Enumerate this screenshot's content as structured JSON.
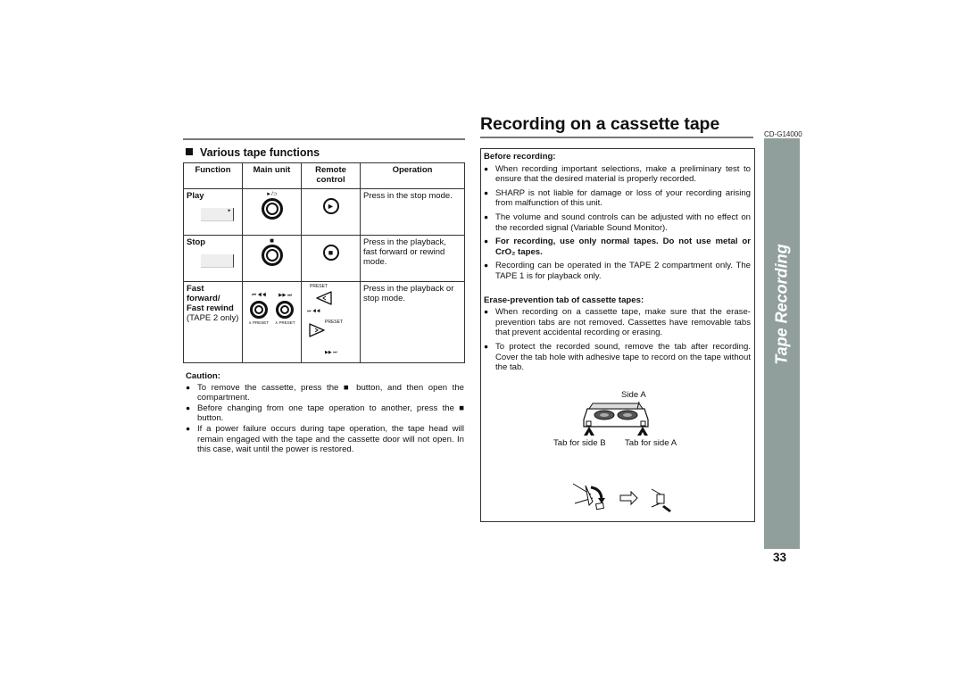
{
  "header": {
    "title": "Recording on a cassette tape",
    "model": "CD-G14000"
  },
  "section": {
    "title": "Various tape functions",
    "table": {
      "headers": [
        "Function",
        "Main unit",
        "Remote control",
        "Operation"
      ],
      "rows": [
        {
          "function": "Play",
          "function_note": "",
          "main_unit_symbol": "►/⊃",
          "remote_symbol": "►",
          "operation": "Press in the stop mode."
        },
        {
          "function": "Stop",
          "function_note": "",
          "main_unit_symbol": "■",
          "remote_symbol": "■",
          "operation": "Press in the playback, fast forward or rewind mode."
        },
        {
          "function": "Fast forward/ Fast rewind",
          "function_note": "(TAPE 2 only)",
          "main_unit_left_symbol": "⏮ ◀◀",
          "main_unit_right_symbol": "▶▶ ⏭",
          "main_unit_left_label": "∨ PRESET",
          "main_unit_right_label": "∧ PRESET",
          "remote_top_label": "PRESET",
          "remote_top_symbol": "⏮ ◀◀",
          "remote_bottom_label": "PRESET",
          "remote_bottom_symbol": "▶▶ ⏭",
          "operation": "Press in the playback or stop mode."
        }
      ]
    }
  },
  "caution": {
    "title": "Caution:",
    "items": [
      "To remove the cassette, press the ■ button, and then open the compartment.",
      "Before changing from one tape operation to another, press the ■ button.",
      "If a power failure occurs during tape operation, the tape head will remain engaged with the tape and the cassette door will not open. In this case, wait until the power is restored."
    ]
  },
  "before_recording": {
    "title": "Before recording:",
    "items": [
      "When recording important selections, make a preliminary test to ensure that the desired material is properly recorded.",
      "SHARP is not liable for damage or loss of your recording arising from malfunction of this unit.",
      "The volume and sound controls can be adjusted with no effect on the recorded signal (Variable Sound Monitor).",
      "For recording, use only normal tapes. Do not use metal or CrO₂ tapes.",
      "Recording can be operated in the TAPE 2 compartment only. The TAPE 1 is for playback only."
    ]
  },
  "erase_prevention": {
    "title": "Erase-prevention tab of cassette tapes:",
    "items": [
      "When recording on a cassette tape, make sure that the erase-prevention tabs are not removed. Cassettes have removable tabs that prevent accidental recording or erasing.",
      "To protect the recorded sound, remove the tab after recording. Cover the tab hole with adhesive tape to record on the tape without the tab."
    ],
    "figure": {
      "side_label": "Side A",
      "tab_b_label": "Tab for side B",
      "tab_a_label": "Tab for side A"
    }
  },
  "sidebar": {
    "label": "Tape Recording",
    "color": "#919f9c"
  },
  "page_number": "33"
}
